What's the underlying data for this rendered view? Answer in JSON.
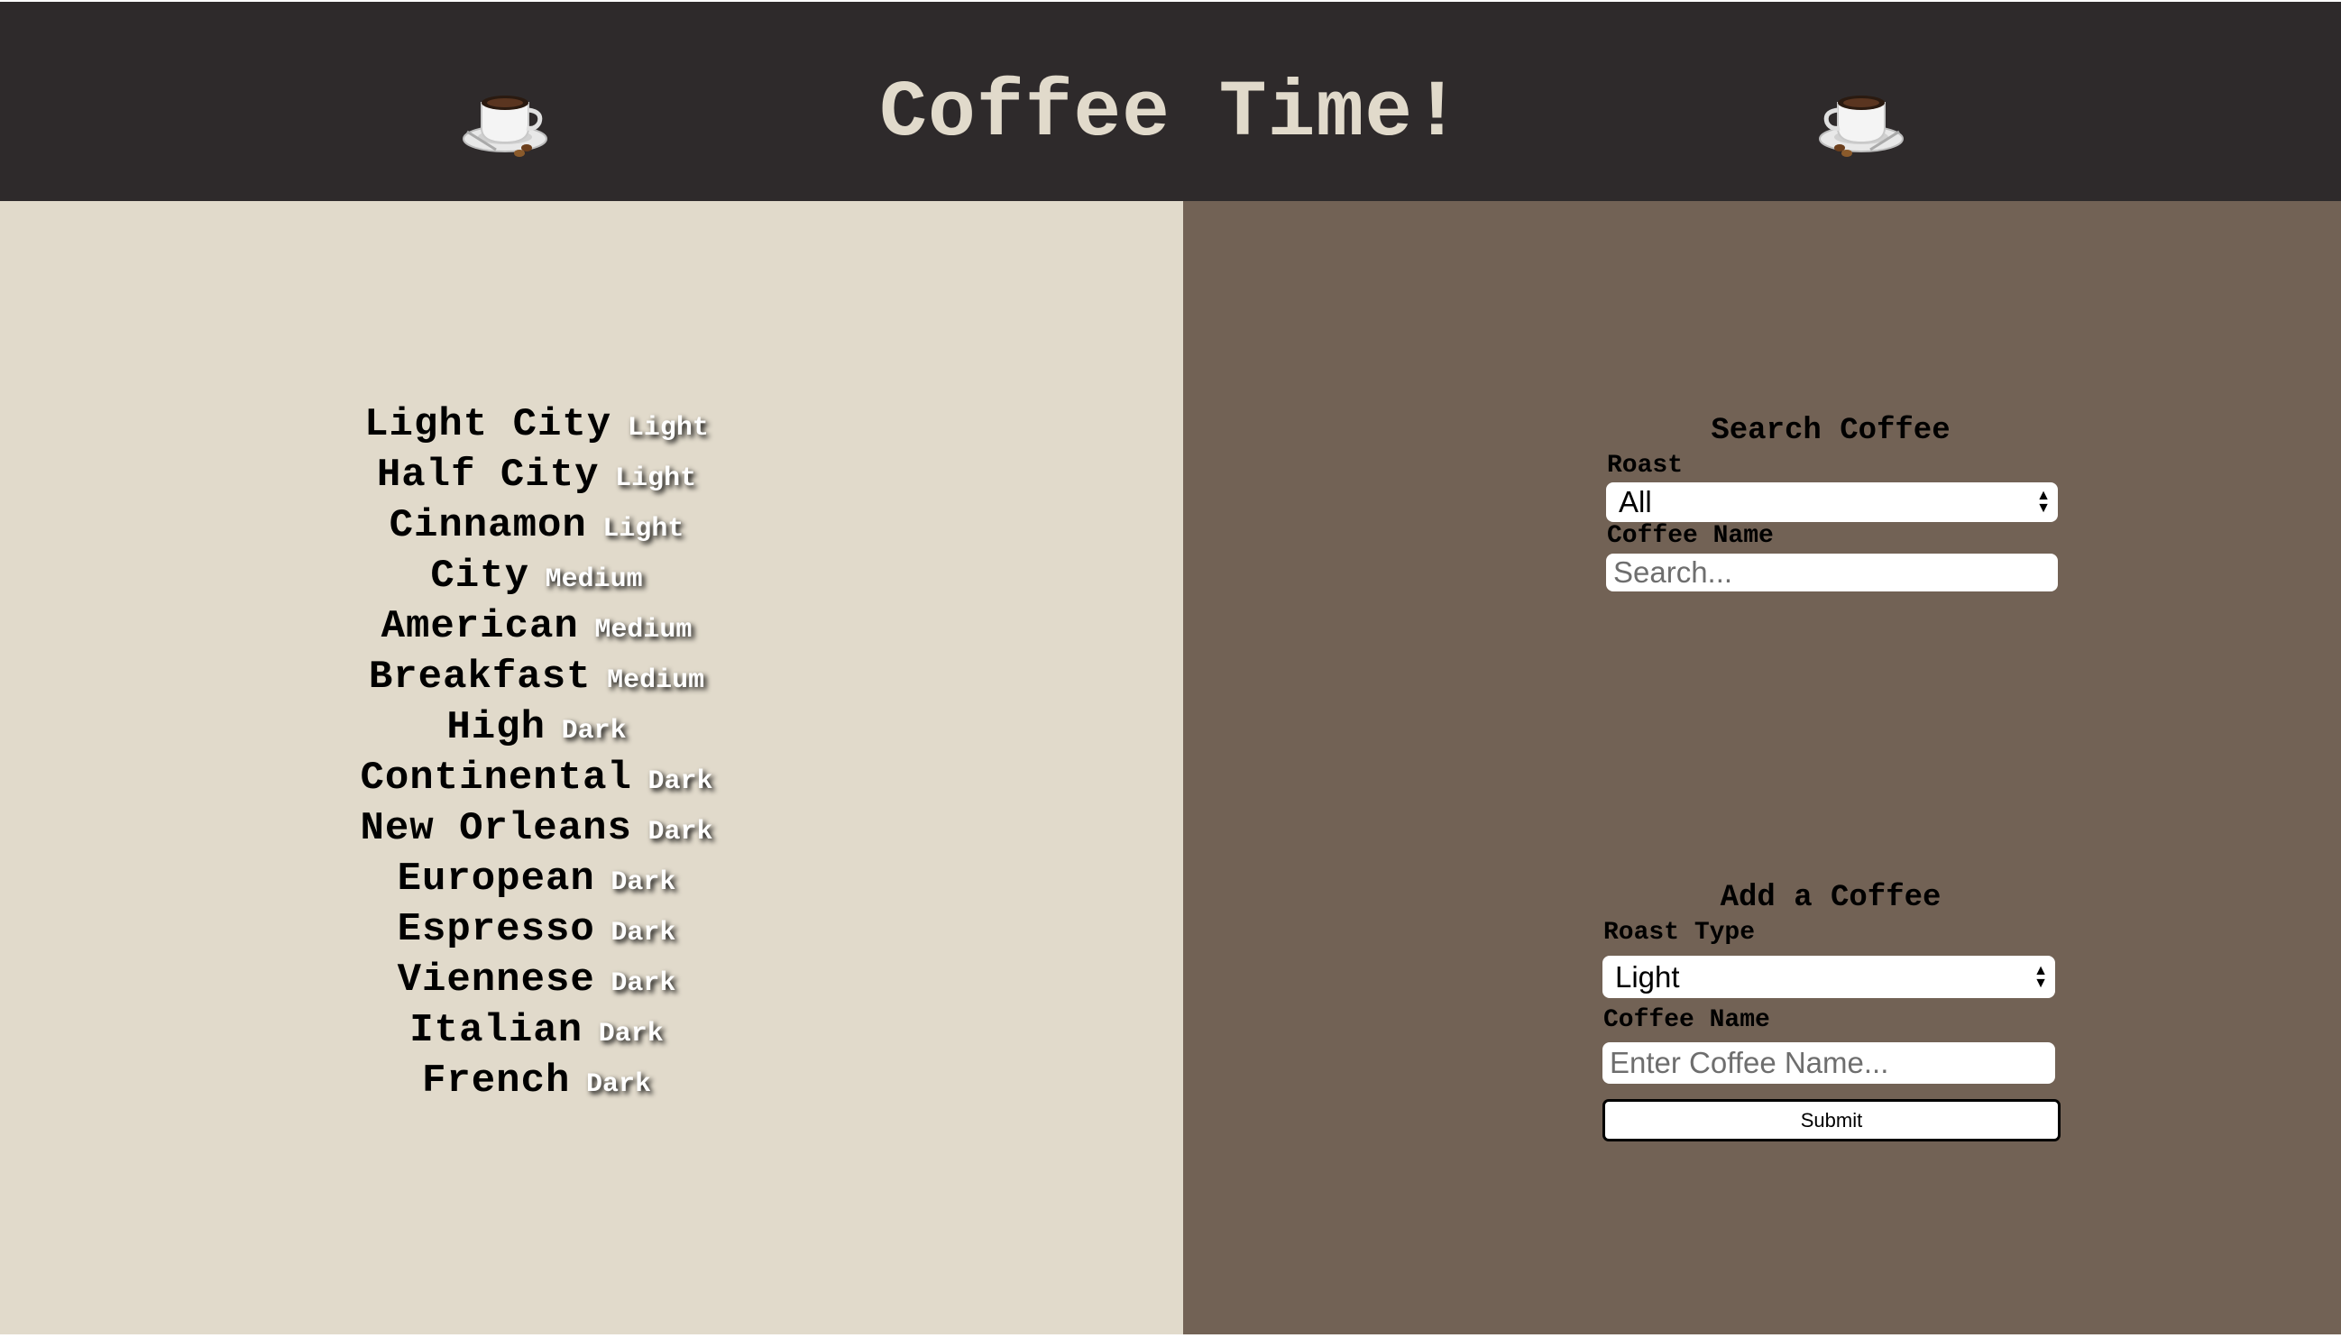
{
  "header": {
    "title": "Coffee Time!",
    "left_icon": "coffee-cup-icon",
    "right_icon": "coffee-cup-icon"
  },
  "coffees": [
    {
      "name": "Light City",
      "roast": "Light"
    },
    {
      "name": "Half City",
      "roast": "Light"
    },
    {
      "name": "Cinnamon",
      "roast": "Light"
    },
    {
      "name": "City",
      "roast": "Medium"
    },
    {
      "name": "American",
      "roast": "Medium"
    },
    {
      "name": "Breakfast",
      "roast": "Medium"
    },
    {
      "name": "High",
      "roast": "Dark"
    },
    {
      "name": "Continental",
      "roast": "Dark"
    },
    {
      "name": "New Orleans",
      "roast": "Dark"
    },
    {
      "name": "European",
      "roast": "Dark"
    },
    {
      "name": "Espresso",
      "roast": "Dark"
    },
    {
      "name": "Viennese",
      "roast": "Dark"
    },
    {
      "name": "Italian",
      "roast": "Dark"
    },
    {
      "name": "French",
      "roast": "Dark"
    }
  ],
  "search": {
    "heading": "Search Coffee",
    "roast_label": "Roast",
    "roast_selected": "All",
    "name_label": "Coffee Name",
    "name_placeholder": "Search..."
  },
  "add": {
    "heading": "Add a Coffee",
    "roast_label": "Roast Type",
    "roast_selected": "Light",
    "name_label": "Coffee Name",
    "name_placeholder": "Enter Coffee Name...",
    "submit_label": "Submit"
  },
  "colors": {
    "header_bg": "#2e2a2b",
    "title": "#e1dacb",
    "left_bg": "#e1dacb",
    "right_bg": "#726255"
  }
}
